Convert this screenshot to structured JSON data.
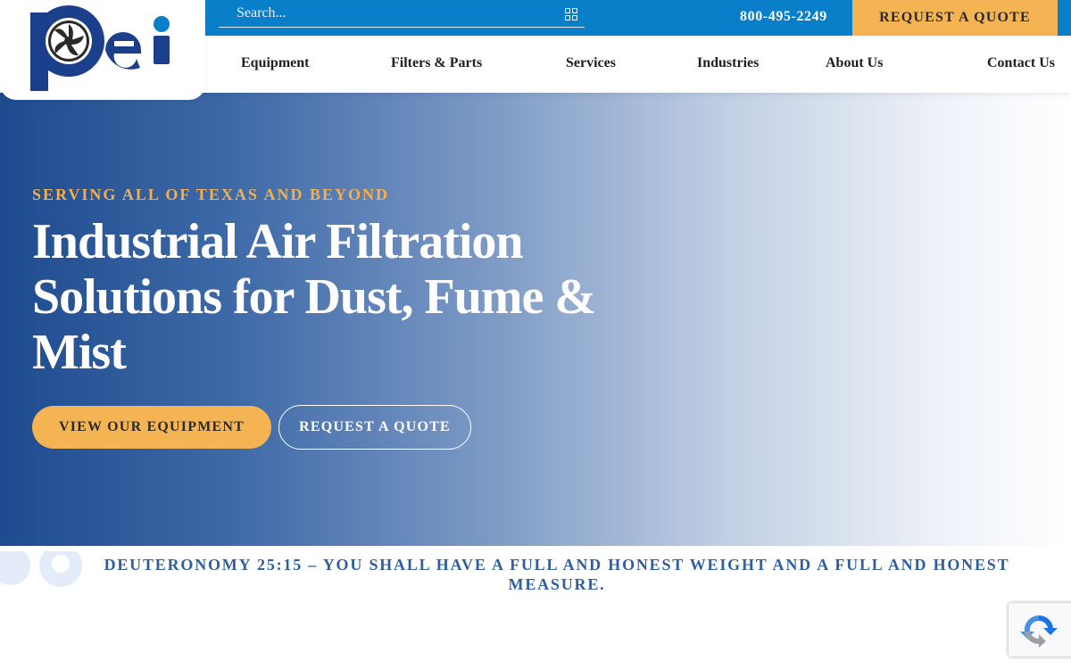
{
  "brand": {
    "logo_text": "pei",
    "logo_colors": [
      "#1c3f8c",
      "#0a7fc9"
    ]
  },
  "topbar": {
    "search_placeholder": "Search...",
    "search_icon": "search-icon",
    "phone": "800-495-2249",
    "quote_button": "REQUEST A QUOTE"
  },
  "nav": {
    "items": [
      {
        "label": "Equipment"
      },
      {
        "label": "Filters & Parts"
      },
      {
        "label": "Services"
      },
      {
        "label": "Industries"
      },
      {
        "label": "About Us"
      },
      {
        "label": "Contact Us"
      }
    ]
  },
  "hero": {
    "eyebrow": "SERVING ALL OF TEXAS AND BEYOND",
    "title": "Industrial Air Filtration Solutions for Dust, Fume & Mist",
    "primary_button": "VIEW OUR EQUIPMENT",
    "secondary_button": "REQUEST A QUOTE"
  },
  "verse": "DEUTERONOMY 25:15 – YOU SHALL HAVE A FULL AND HONEST WEIGHT AND A FULL AND HONEST MEASURE.",
  "colors": {
    "topbar": "#0a7fc9",
    "accent": "#f5b453",
    "eyebrow": "#f2b04e",
    "verse": "#2f5f9e",
    "hero_start": "#1e4b8f"
  }
}
